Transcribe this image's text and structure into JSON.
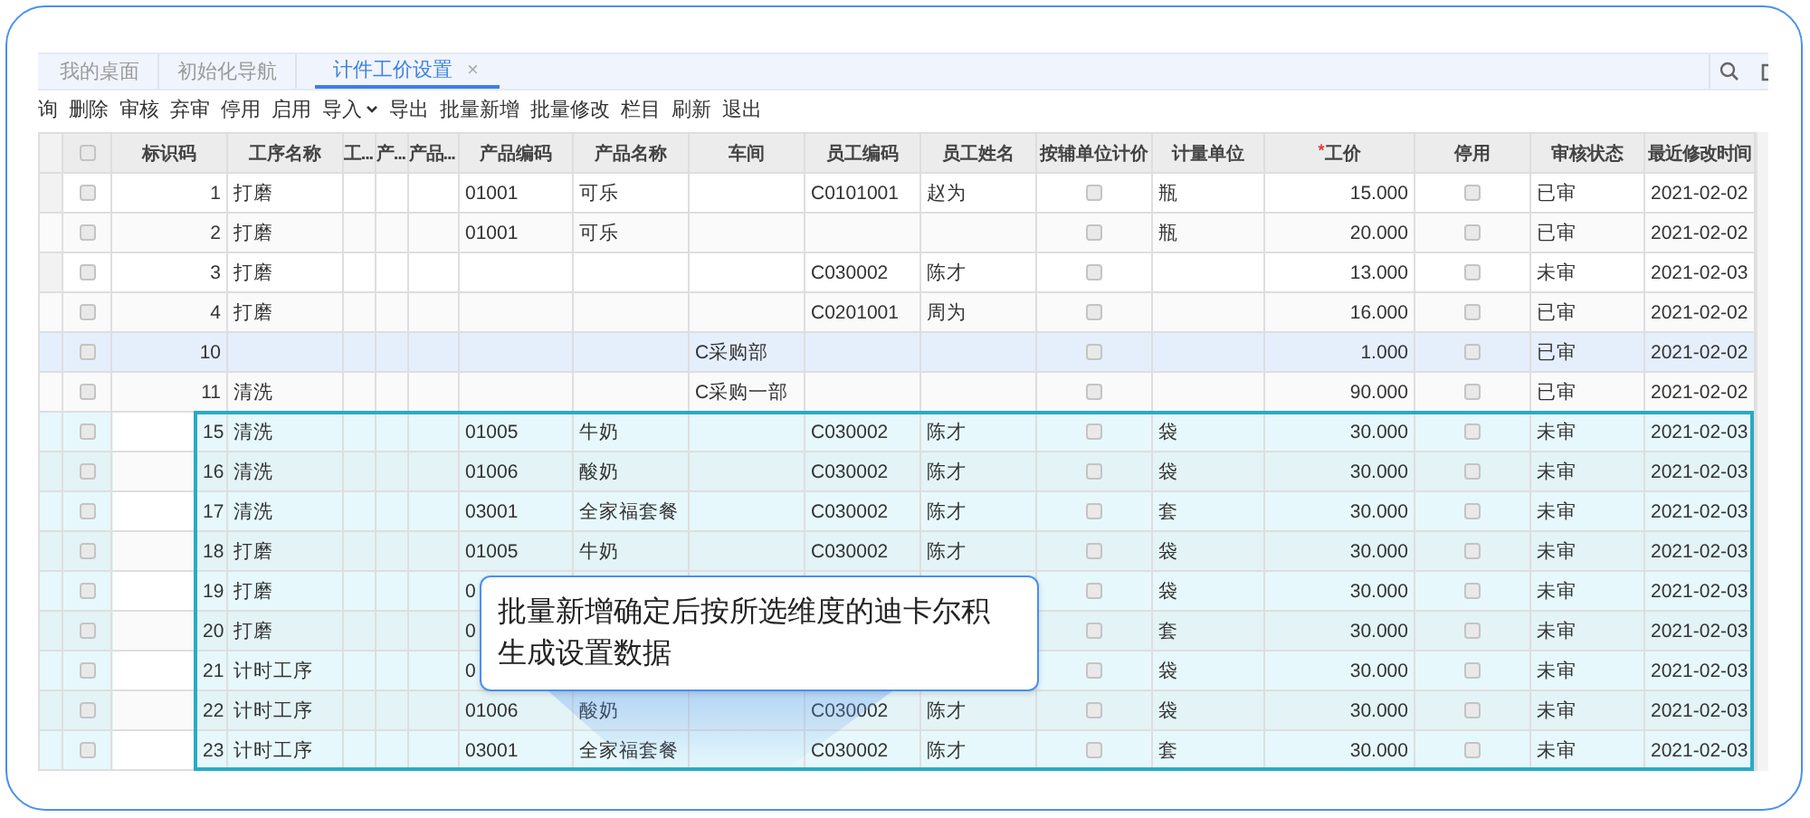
{
  "tabs": [
    {
      "label": "我的桌面",
      "selected": false
    },
    {
      "label": "初始化导航",
      "selected": false
    },
    {
      "label": "计件工价设置",
      "selected": true,
      "close": "×"
    }
  ],
  "toolbar": [
    {
      "label": "询"
    },
    {
      "label": "删除"
    },
    {
      "label": "审核"
    },
    {
      "label": "弃审"
    },
    {
      "label": "停用"
    },
    {
      "label": "启用"
    },
    {
      "label": "导入",
      "dropdown": true
    },
    {
      "label": "导出"
    },
    {
      "label": "批量新增"
    },
    {
      "label": "批量修改"
    },
    {
      "label": "栏目"
    },
    {
      "label": "刷新"
    },
    {
      "label": "退出"
    }
  ],
  "table": {
    "all_checked": false,
    "columns": [
      {
        "label": "标识码"
      },
      {
        "label": "工序名称"
      },
      {
        "label": "工..."
      },
      {
        "label": "产..."
      },
      {
        "label": "产品..."
      },
      {
        "label": "产品编码"
      },
      {
        "label": "产品名称"
      },
      {
        "label": "车间"
      },
      {
        "label": "员工编码"
      },
      {
        "label": "员工姓名"
      },
      {
        "label": "按辅单位计价"
      },
      {
        "label": "计量单位"
      },
      {
        "label": "工价",
        "required_mark": "*"
      },
      {
        "label": "停用"
      },
      {
        "label": "审核状态"
      },
      {
        "label": "最近修改时间"
      }
    ],
    "rows": [
      {
        "kind": "existing",
        "selected": false,
        "checked": false,
        "id": "1",
        "process": "打磨",
        "product_code": "01001",
        "product_name": "可乐",
        "employee_code": "C0101001",
        "employee_name": "赵为",
        "aux_pricing": false,
        "unit": "瓶",
        "price": "15.000",
        "disabled": false,
        "audit_status": "已审",
        "modified": "2021-02-02"
      },
      {
        "kind": "existing",
        "selected": false,
        "checked": false,
        "id": "2",
        "process": "打磨",
        "product_code": "01001",
        "product_name": "可乐",
        "aux_pricing": false,
        "unit": "瓶",
        "price": "20.000",
        "disabled": false,
        "audit_status": "已审",
        "modified": "2021-02-02"
      },
      {
        "kind": "existing",
        "selected": false,
        "checked": false,
        "id": "3",
        "process": "打磨",
        "employee_code": "C030002",
        "employee_name": "陈才",
        "aux_pricing": false,
        "price": "13.000",
        "disabled": false,
        "audit_status": "未审",
        "modified": "2021-02-03"
      },
      {
        "kind": "existing",
        "selected": false,
        "checked": false,
        "id": "4",
        "process": "打磨",
        "employee_code": "C0201001",
        "employee_name": "周为",
        "aux_pricing": false,
        "price": "16.000",
        "disabled": false,
        "audit_status": "已审",
        "modified": "2021-02-02"
      },
      {
        "kind": "existing",
        "selected": true,
        "checked": false,
        "id": "10",
        "workshop": "C采购部",
        "aux_pricing": false,
        "price": "1.000",
        "disabled": false,
        "audit_status": "已审",
        "modified": "2021-02-02"
      },
      {
        "kind": "existing",
        "selected": false,
        "checked": false,
        "id": "11",
        "process": "清洗",
        "workshop": "C采购一部",
        "aux_pricing": false,
        "price": "90.000",
        "disabled": false,
        "audit_status": "已审",
        "modified": "2021-02-02"
      },
      {
        "kind": "new",
        "selected": false,
        "checked": false,
        "id": "15",
        "process": "清洗",
        "product_code": "01005",
        "product_name": "牛奶",
        "employee_code": "C030002",
        "employee_name": "陈才",
        "aux_pricing": false,
        "unit": "袋",
        "price": "30.000",
        "disabled": false,
        "audit_status": "未审",
        "modified": "2021-02-03"
      },
      {
        "kind": "new",
        "selected": false,
        "checked": false,
        "id": "16",
        "process": "清洗",
        "product_code": "01006",
        "product_name": "酸奶",
        "employee_code": "C030002",
        "employee_name": "陈才",
        "aux_pricing": false,
        "unit": "袋",
        "price": "30.000",
        "disabled": false,
        "audit_status": "未审",
        "modified": "2021-02-03"
      },
      {
        "kind": "new",
        "selected": false,
        "checked": false,
        "id": "17",
        "process": "清洗",
        "product_code": "03001",
        "product_name": "全家福套餐",
        "employee_code": "C030002",
        "employee_name": "陈才",
        "aux_pricing": false,
        "unit": "套",
        "price": "30.000",
        "disabled": false,
        "audit_status": "未审",
        "modified": "2021-02-03"
      },
      {
        "kind": "new",
        "selected": false,
        "checked": false,
        "id": "18",
        "process": "打磨",
        "product_code": "01005",
        "product_name": "牛奶",
        "employee_code": "C030002",
        "employee_name": "陈才",
        "aux_pricing": false,
        "unit": "袋",
        "price": "30.000",
        "disabled": false,
        "audit_status": "未审",
        "modified": "2021-02-03"
      },
      {
        "kind": "new",
        "selected": false,
        "checked": false,
        "id": "19",
        "process": "打磨",
        "product_code": "0",
        "aux_pricing": false,
        "unit": "袋",
        "price": "30.000",
        "disabled": false,
        "audit_status": "未审",
        "modified": "2021-02-03"
      },
      {
        "kind": "new",
        "selected": false,
        "checked": false,
        "id": "20",
        "process": "打磨",
        "product_code": "0",
        "aux_pricing": false,
        "unit": "套",
        "price": "30.000",
        "disabled": false,
        "audit_status": "未审",
        "modified": "2021-02-03"
      },
      {
        "kind": "new",
        "selected": false,
        "checked": false,
        "id": "21",
        "process": "计时工序",
        "product_code": "0",
        "aux_pricing": false,
        "unit": "袋",
        "price": "30.000",
        "disabled": false,
        "audit_status": "未审",
        "modified": "2021-02-03"
      },
      {
        "kind": "new",
        "selected": false,
        "checked": false,
        "id": "22",
        "process": "计时工序",
        "product_code": "01006",
        "product_name": "酸奶",
        "employee_code": "C030002",
        "employee_name": "陈才",
        "aux_pricing": false,
        "unit": "袋",
        "price": "30.000",
        "disabled": false,
        "audit_status": "未审",
        "modified": "2021-02-03"
      },
      {
        "kind": "new",
        "selected": false,
        "checked": false,
        "id": "23",
        "process": "计时工序",
        "product_code": "03001",
        "product_name": "全家福套餐",
        "employee_code": "C030002",
        "employee_name": "陈才",
        "aux_pricing": false,
        "unit": "套",
        "price": "30.000",
        "disabled": false,
        "audit_status": "未审",
        "modified": "2021-02-03"
      }
    ]
  },
  "callout": {
    "text": "批量新增确定后按所选维度的迪卡尔积生成设置数据"
  }
}
